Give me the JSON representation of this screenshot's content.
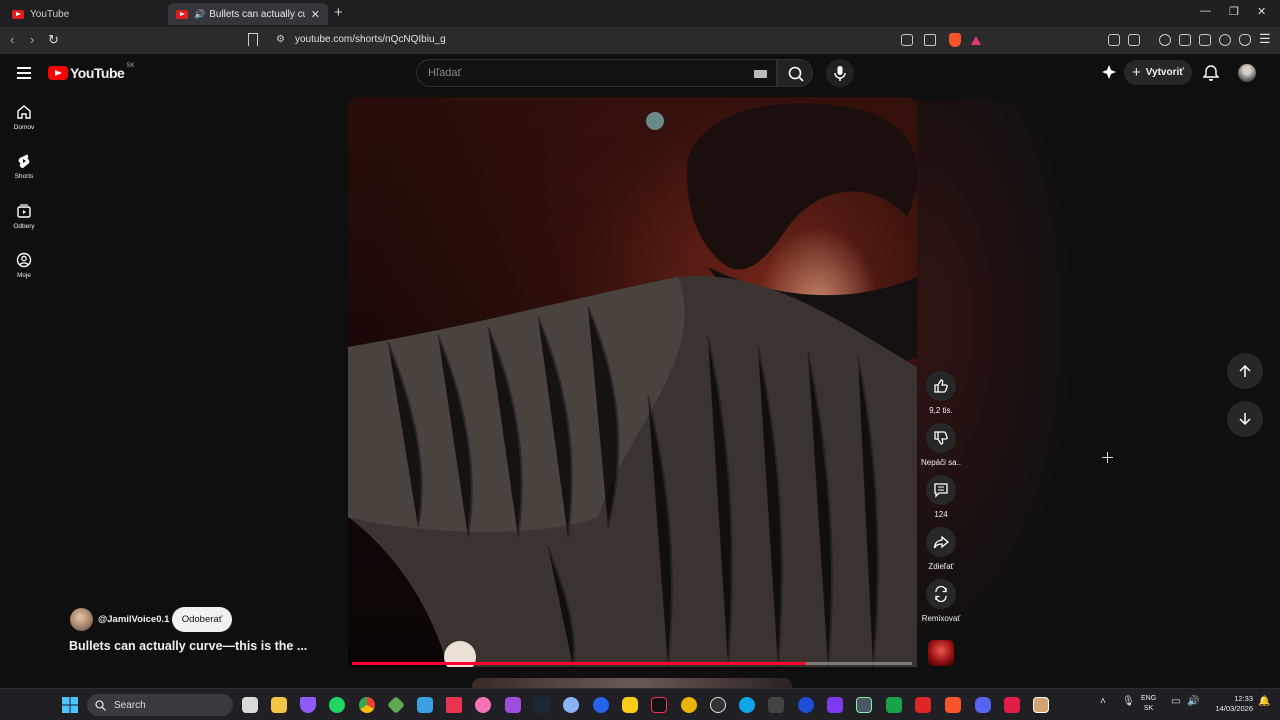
{
  "browser": {
    "tabs": [
      {
        "title": "YouTube",
        "active": false
      },
      {
        "title": "Bullets can actually curve—this is the ...",
        "active": true
      }
    ],
    "url": "youtube.com/shorts/nQcNQIbiu_g"
  },
  "header": {
    "logo_text": "YouTube",
    "country_code": "SK",
    "search_placeholder": "Hľadať",
    "create_label": "Vytvoriť"
  },
  "sidebar": {
    "items": [
      {
        "label": "Domov",
        "icon": "home-icon"
      },
      {
        "label": "Shorts",
        "icon": "shorts-icon"
      },
      {
        "label": "Odbery",
        "icon": "subscriptions-icon"
      },
      {
        "label": "Moje",
        "icon": "you-icon"
      }
    ]
  },
  "video": {
    "channel": "@JamilVoice0.1",
    "subscribe_label": "Odoberať",
    "title": "Bullets can actually curve—this is the ...",
    "progress_percent": 81
  },
  "actions": {
    "like_count": "9,2 tis.",
    "dislike_label": "Nepáči sa..",
    "comment_count": "124",
    "share_label": "Zdieľať",
    "remix_label": "Remixovať"
  },
  "taskbar": {
    "search_label": "Search",
    "lang_top": "ENG",
    "lang_bottom": "SK",
    "time": "12:33",
    "date": "14/03/2026"
  },
  "colors": {
    "accent": "#ff0033",
    "brand_red": "#ff0000",
    "background": "#0f0f0f"
  }
}
